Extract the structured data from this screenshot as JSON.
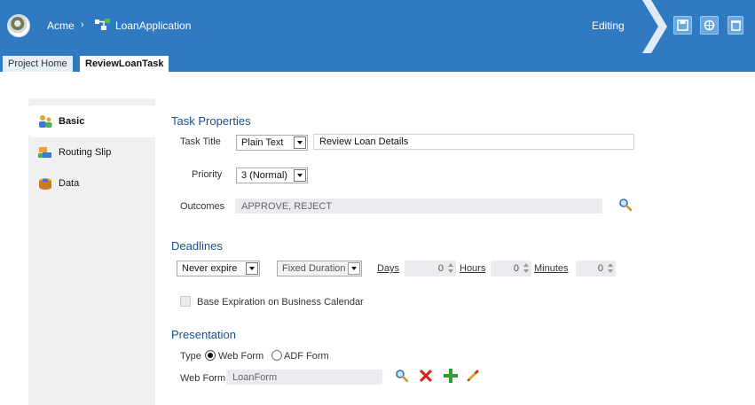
{
  "header": {
    "breadcrumb_root": "Acme",
    "breadcrumb_sep": "›",
    "app_name": "LoanApplication",
    "mode": "Editing",
    "colors": {
      "bar": "#2f7ac1",
      "title": "#1a4f8b"
    },
    "tools": [
      "save-icon",
      "deploy-icon",
      "delete-icon"
    ]
  },
  "tabs": [
    {
      "label": "Project Home",
      "active": false
    },
    {
      "label": "ReviewLoanTask",
      "active": true
    }
  ],
  "nav": [
    {
      "label": "Basic",
      "icon": "people-icon",
      "active": true
    },
    {
      "label": "Routing Slip",
      "icon": "routing-icon",
      "active": false
    },
    {
      "label": "Data",
      "icon": "data-icon",
      "active": false
    }
  ],
  "task_properties": {
    "title": "Task Properties",
    "task_title_label": "Task Title",
    "task_title_type": "Plain Text",
    "task_title_value": "Review Loan  Details",
    "priority_label": "Priority",
    "priority_value": "3 (Normal)",
    "outcomes_label": "Outcomes",
    "outcomes_value": "APPROVE, REJECT"
  },
  "deadlines": {
    "title": "Deadlines",
    "expire_value": "Never expire",
    "duration_value": "Fixed Duration",
    "days_label": "Days",
    "days_value": "0",
    "hours_label": "Hours",
    "hours_value": "0",
    "minutes_label": "Minutes",
    "minutes_value": "0",
    "business_calendar_label": "Base Expiration on Business Calendar",
    "business_calendar_checked": false
  },
  "presentation": {
    "title": "Presentation",
    "type_label": "Type",
    "option_web": "Web Form",
    "option_adf": "ADF Form",
    "selected": "Web Form",
    "webform_label": "Web Form",
    "webform_value": "LoanForm"
  }
}
